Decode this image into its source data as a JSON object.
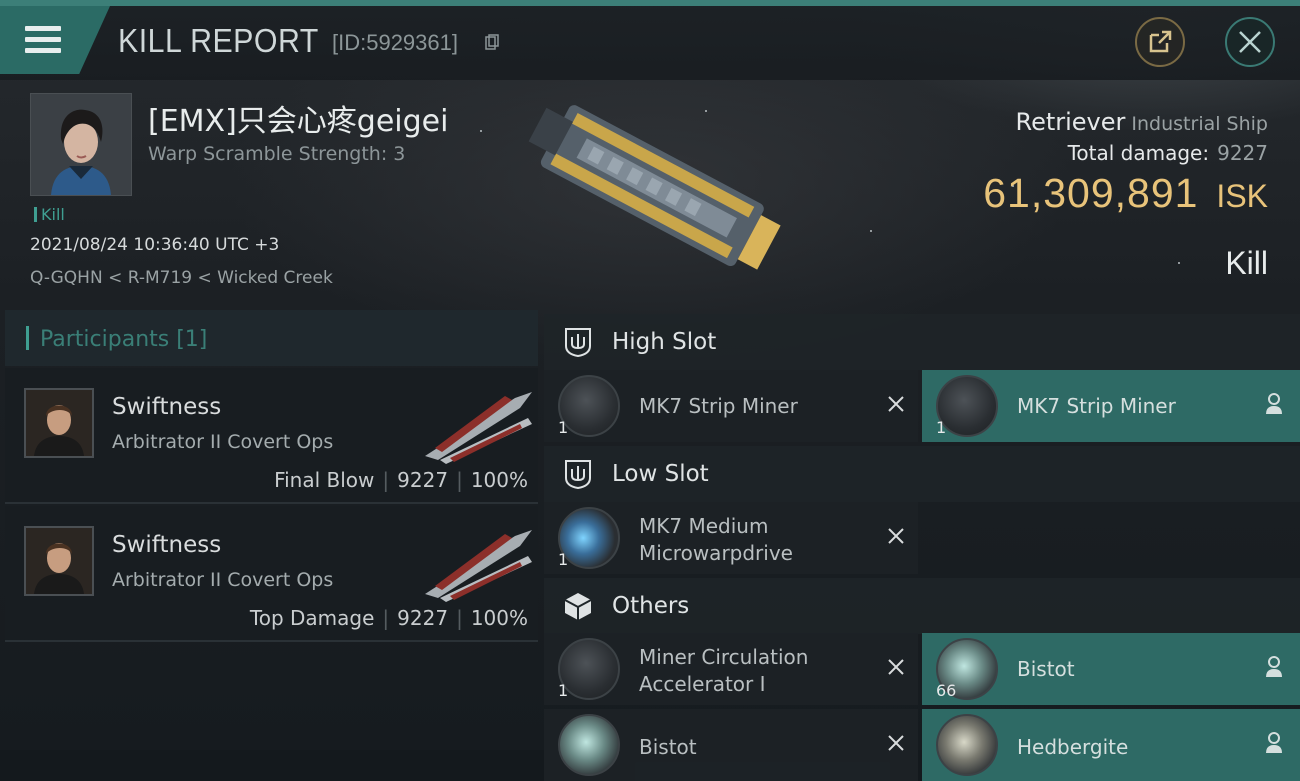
{
  "header": {
    "title": "KILL REPORT",
    "report_id": "[ID:5929361]",
    "icons": {
      "menu": "hamburger-menu-icon",
      "copy": "copy-icon",
      "share": "share-external-icon",
      "close": "close-icon"
    }
  },
  "victim": {
    "name": "[EMX]只会心疼geigei",
    "subtitle": "Warp Scramble Strength: 3",
    "tag": "Kill",
    "datetime": "2021/08/24 10:36:40 UTC +3",
    "location": "Q-GQHN < R-M719 < Wicked Creek",
    "ship_name": "Retriever",
    "ship_class": "Industrial Ship",
    "total_damage_label": "Total damage:",
    "total_damage": "9227",
    "isk_value": "61,309,891",
    "isk_unit": "ISK",
    "result": "Kill"
  },
  "participants": {
    "title": "Participants [1]",
    "rows": [
      {
        "name": "Swiftness",
        "ship": "Arbitrator II Covert Ops",
        "role": "Final Blow",
        "damage": "9227",
        "percent": "100%"
      },
      {
        "name": "Swiftness",
        "ship": "Arbitrator II Covert Ops",
        "role": "Top Damage",
        "damage": "9227",
        "percent": "100%"
      }
    ]
  },
  "fitting": {
    "high_slot": {
      "title": "High Slot",
      "modules": [
        {
          "name": "MK7 Strip Miner",
          "qty": "1",
          "status": "destroyed"
        },
        {
          "name": "MK7 Strip Miner",
          "qty": "1",
          "status": "dropped"
        }
      ]
    },
    "low_slot": {
      "title": "Low Slot",
      "modules": [
        {
          "name_line1": "MK7 Medium",
          "name_line2": "Microwarpdrive",
          "qty": "1",
          "status": "destroyed"
        }
      ]
    },
    "others": {
      "title": "Others",
      "modules": [
        {
          "name_line1": "Miner Circulation",
          "name_line2": "Accelerator I",
          "qty": "1",
          "status": "destroyed"
        },
        {
          "name": "Bistot",
          "qty": "66",
          "status": "dropped"
        },
        {
          "name": "Bistot",
          "status": "destroyed"
        },
        {
          "name": "Hedbergite",
          "status": "dropped"
        }
      ]
    }
  },
  "colors": {
    "accent_teal": "#3f9f92",
    "dropped_bg": "#2e6a65",
    "isk_gold": "#e8c37a"
  }
}
